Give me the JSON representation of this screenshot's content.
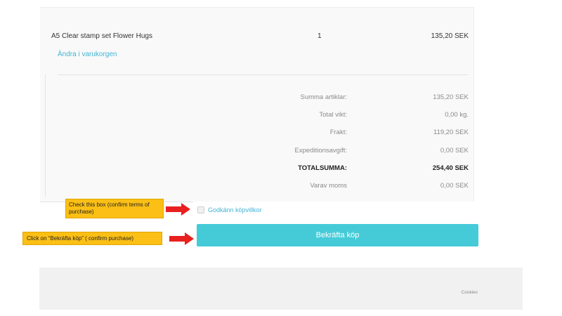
{
  "product": {
    "name": "A5 Clear stamp set Flower Hugs",
    "quantity": "1",
    "price": "135,20 SEK",
    "edit_link": "Ändra i varukorgen"
  },
  "summary": [
    {
      "label": "Summa artiklar:",
      "value": "135,20 SEK",
      "total": false
    },
    {
      "label": "Total vikt:",
      "value": "0,00 kg.",
      "total": false
    },
    {
      "label": "Frakt:",
      "value": "119,20 SEK",
      "total": false
    },
    {
      "label": "Expeditionsavgift:",
      "value": "0,00 SEK",
      "total": false
    },
    {
      "label": "TOTALSUMMA:",
      "value": "254,40 SEK",
      "total": true
    },
    {
      "label": "Varav moms",
      "value": "0,00 SEK",
      "total": false
    }
  ],
  "terms": {
    "label": "Godkänn köpvillkor",
    "checked": false
  },
  "confirm_button": {
    "label": "Bekräfta köp"
  },
  "annotations": {
    "checkbox_callout": "Check this box (confirm terms of purchase)",
    "confirm_callout": "Click on “Bekräfta köp” ( confirm purchase)"
  },
  "footer": {
    "cookies": "Cookies"
  },
  "colors": {
    "accent": "#45cbd8",
    "link": "#43b4d4",
    "callout": "#fbbf15",
    "arrow": "#e8201f"
  }
}
